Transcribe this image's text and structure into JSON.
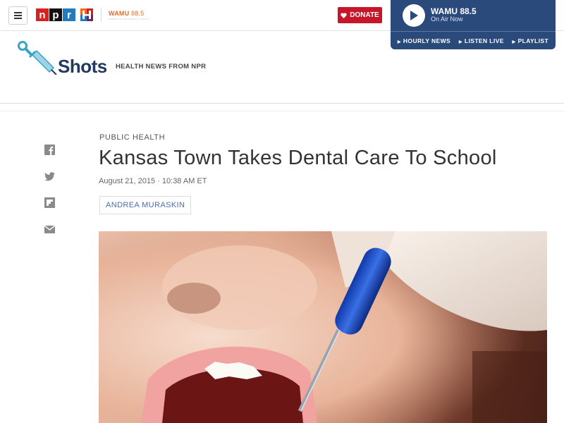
{
  "topbar": {
    "brand_letters": [
      "n",
      "p",
      "r"
    ],
    "station_logo": "WAMU",
    "station_freq": "88.5",
    "station_tagline": "AMERICAN UNIVERSITY RADIO",
    "donate_label": "DONATE",
    "icons": [
      "menu-icon",
      "heart-icon",
      "h-logo-icon"
    ]
  },
  "player": {
    "station": "WAMU 88.5",
    "status": "On Air Now",
    "links": [
      "HOURLY NEWS",
      "LISTEN LIVE",
      "PLAYLIST"
    ],
    "background": "#2b4a7c"
  },
  "section": {
    "name": "Shots",
    "tagline": "HEALTH NEWS FROM NPR"
  },
  "share_icons": [
    "facebook-icon",
    "twitter-icon",
    "flipboard-icon",
    "email-icon"
  ],
  "article": {
    "kicker": "PUBLIC HEALTH",
    "headline": "Kansas Town Takes Dental Care To School",
    "dateline": "August 21, 2015 · 10:38 AM ET",
    "author": "ANDREA MURASKIN",
    "photo_subject": "child-dental-exam-photo"
  },
  "colors": {
    "npr_red": "#d62021",
    "npr_black": "#111111",
    "npr_blue": "#237bbd",
    "donate": "#c7152a",
    "shots_navy": "#24395f",
    "byline_link": "#4b6ea5"
  }
}
